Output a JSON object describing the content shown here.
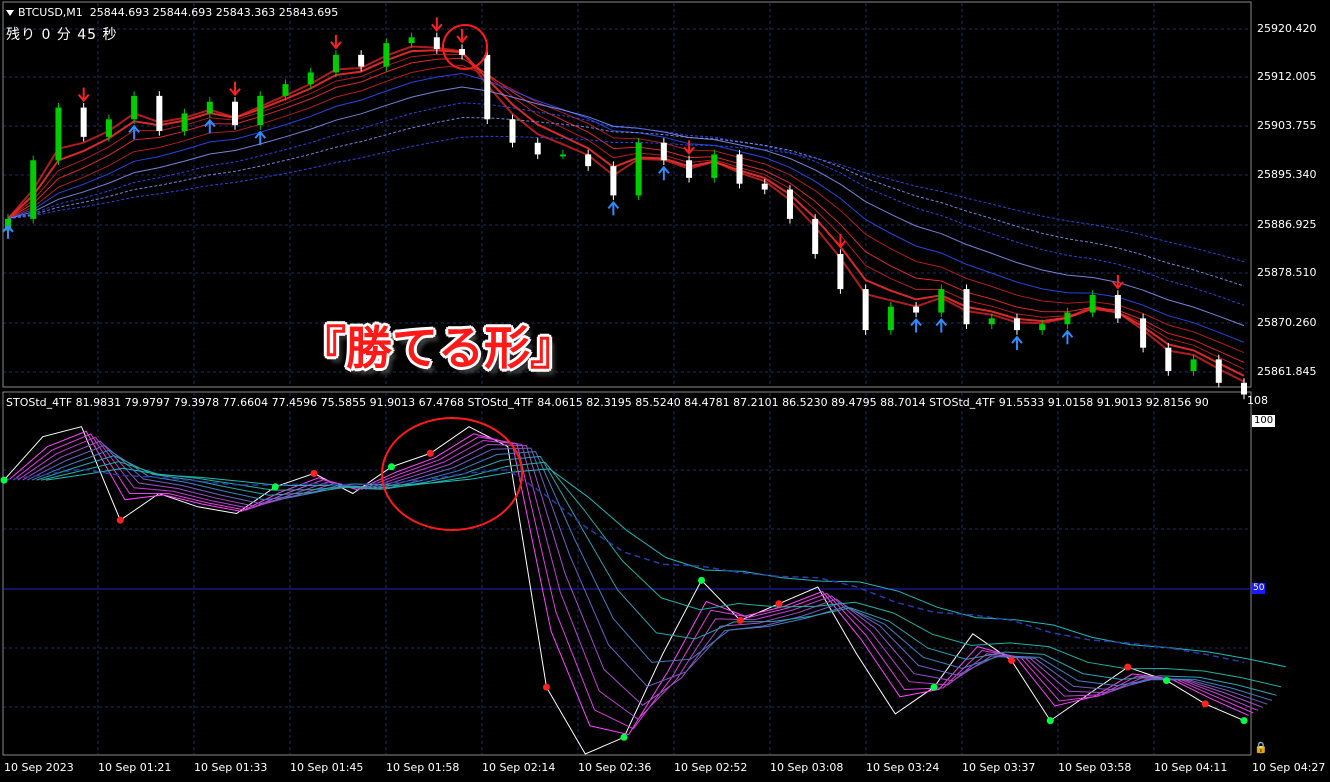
{
  "header": {
    "symbol": "BTCUSD,M1",
    "ohlc": "25844.693 25844.693 25843.363 25843.695",
    "timer": "残り 0 分 45 秒"
  },
  "banner": {
    "text": "『勝てる形』"
  },
  "indicator": {
    "label": "STOStd_4TF 81.9831 79.9797 79.3978 77.6604 77.4596 75.5855 91.9013 67.4768  STOStd_4TF 84.0615 82.3195 85.5240 84.4781 87.2101 86.5230 89.4795 88.7014  STOStd_4TF 91.5533 91.0158 91.9013 92.8156 90",
    "scale_top": "108",
    "level_100": "100",
    "level_50": "50"
  },
  "price_axis": [
    "25920.420",
    "25912.005",
    "25903.755",
    "25895.340",
    "25886.925",
    "25878.510",
    "25870.260",
    "25861.845"
  ],
  "time_axis": [
    "10 Sep 2023",
    "10 Sep 01:21",
    "10 Sep 01:33",
    "10 Sep 01:45",
    "10 Sep 01:58",
    "10 Sep 02:14",
    "10 Sep 02:36",
    "10 Sep 02:52",
    "10 Sep 03:08",
    "10 Sep 03:24",
    "10 Sep 03:37",
    "10 Sep 03:58",
    "10 Sep 04:11",
    "10 Sep 04:27"
  ],
  "colors": {
    "background": "#000000",
    "grid": "#1c2a6e",
    "bull": "#00cc00",
    "bear": "#ffffff",
    "down_arrow": "#ff2020",
    "up_arrow": "#2f8cff",
    "highlight_circle": "#ff1a1a"
  },
  "chart_data": {
    "type": "line",
    "price_close_estimate": [
      25888,
      25898,
      25907,
      25902,
      25905,
      25909,
      25903,
      25906,
      25908,
      25904,
      25909,
      25911,
      25913,
      25916,
      25914,
      25918,
      25919,
      25917,
      25916,
      25905,
      25901,
      25899,
      25899,
      25897,
      25892,
      25901,
      25898,
      25895,
      25899,
      25894,
      25893,
      25888,
      25882,
      25876,
      25869,
      25873,
      25872,
      25876,
      25870,
      25871,
      25869,
      25870,
      25872,
      25875,
      25871,
      25866,
      25862,
      25864,
      25860,
      25858
    ],
    "stochastic_estimate": [
      82,
      95,
      98,
      70,
      78,
      74,
      72,
      80,
      84,
      78,
      86,
      90,
      98,
      92,
      20,
      0,
      5,
      30,
      52,
      40,
      45,
      50,
      30,
      12,
      20,
      36,
      28,
      10,
      18,
      26,
      22,
      15,
      10
    ]
  }
}
